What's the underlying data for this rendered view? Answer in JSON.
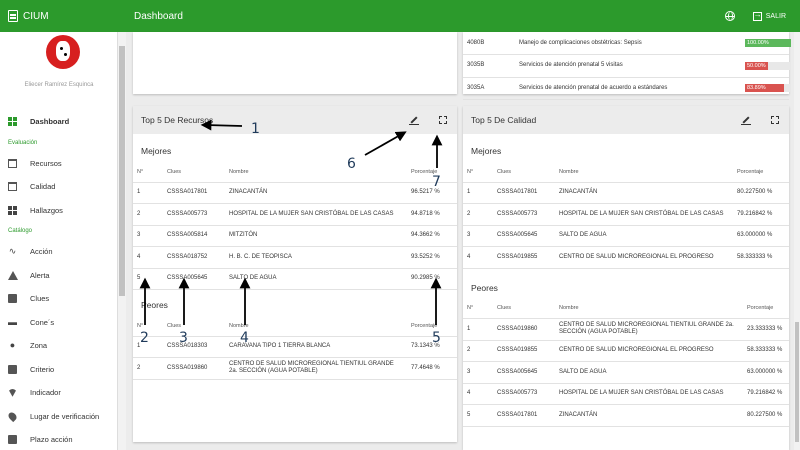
{
  "app": {
    "name": "CIUM",
    "page_title": "Dashboard",
    "logout_label": "SALIR"
  },
  "user": {
    "name": "Eliecer Ramírez Esquinca"
  },
  "sidebar": {
    "dashboard": "Dashboard",
    "section_evaluacion": "Evaluación",
    "evaluacion_items": [
      "Recursos",
      "Calidad",
      "Hallazgos"
    ],
    "section_catalogo": "Catálogo",
    "catalogo_items": [
      "Acción",
      "Alerta",
      "Clues",
      "Cone´s",
      "Zona",
      "Criterio",
      "Indicador",
      "Lugar de verificación",
      "Plazo acción"
    ]
  },
  "indicators_card": {
    "rows": [
      {
        "code": "4080B",
        "desc": "Manejo de complicaciones obstétricas: Sepsis",
        "value": "100.00%",
        "pct": 100,
        "color": "#5cb85c"
      },
      {
        "code": "3035B",
        "desc": "Servicios de atención prenatal 5 visitas",
        "value": "50.00%",
        "pct": 50,
        "color": "#d9534f"
      },
      {
        "code": "3035A",
        "desc": "Servicios de atención prenatal de acuerdo a estándares",
        "value": "83.89%",
        "pct": 83.89,
        "color": "#d9534f"
      }
    ]
  },
  "recursos": {
    "title": "Top 5 De Recursos",
    "mejores_label": "Mejores",
    "peores_label": "Peores",
    "headers": {
      "n": "N°",
      "clues": "Clues",
      "nombre": "Nombre",
      "porcentaje": "Porcentaje"
    },
    "mejores": [
      {
        "n": "1",
        "clues": "CSSSA017801",
        "nombre": "ZINACANTÁN",
        "pct": "96.5217 %"
      },
      {
        "n": "2",
        "clues": "CSSSA005773",
        "nombre": "HOSPITAL DE LA MUJER SAN CRISTÓBAL DE LAS CASAS",
        "pct": "94.8718 %"
      },
      {
        "n": "3",
        "clues": "CSSSA005814",
        "nombre": "MITZITÓN",
        "pct": "94.3662 %"
      },
      {
        "n": "4",
        "clues": "CSSSA018752",
        "nombre": "H. B. C. DE TEOPISCA",
        "pct": "93.5252 %"
      },
      {
        "n": "5",
        "clues": "CSSSA005645",
        "nombre": "SALTO DE AGUA",
        "pct": "90.2985 %"
      }
    ],
    "peores": [
      {
        "n": "1",
        "clues": "CSSSA018303",
        "nombre": "CARAVANA TIPO 1 TIERRA BLANCA",
        "pct": "73.1343 %"
      },
      {
        "n": "2",
        "clues": "CSSSA019860",
        "nombre": "CENTRO DE SALUD MICROREGIONAL TIENTIUL GRANDE 2a. SECCIÓN (AGUA POTABLE)",
        "pct": "77.4648 %"
      }
    ]
  },
  "calidad": {
    "title": "Top 5 De Calidad",
    "mejores_label": "Mejores",
    "peores_label": "Peores",
    "headers": {
      "n": "N°",
      "clues": "Clues",
      "nombre": "Nombre",
      "porcentaje": "Porcentaje"
    },
    "mejores": [
      {
        "n": "1",
        "clues": "CSSSA017801",
        "nombre": "ZINACANTÁN",
        "pct": "80.227500 %"
      },
      {
        "n": "2",
        "clues": "CSSSA005773",
        "nombre": "HOSPITAL DE LA MUJER SAN CRISTÓBAL DE LAS CASAS",
        "pct": "79.216842 %"
      },
      {
        "n": "3",
        "clues": "CSSSA005645",
        "nombre": "SALTO DE AGUA",
        "pct": "63.000000 %"
      },
      {
        "n": "4",
        "clues": "CSSSA019855",
        "nombre": "CENTRO DE SALUD MICROREGIONAL EL PROGRESO",
        "pct": "58.333333 %"
      }
    ],
    "peores": [
      {
        "n": "1",
        "clues": "CSSSA019860",
        "nombre": "CENTRO DE SALUD MICROREGIONAL TIENTIUL GRANDE 2a. SECCIÓN (AGUA POTABLE)",
        "pct": "23.333333 %"
      },
      {
        "n": "2",
        "clues": "CSSSA019855",
        "nombre": "CENTRO DE SALUD MICROREGIONAL EL PROGRESO",
        "pct": "58.333333 %"
      },
      {
        "n": "3",
        "clues": "CSSSA005645",
        "nombre": "SALTO DE AGUA",
        "pct": "63.000000 %"
      },
      {
        "n": "4",
        "clues": "CSSSA005773",
        "nombre": "HOSPITAL DE LA MUJER SAN CRISTÓBAL DE LAS CASAS",
        "pct": "79.216842 %"
      },
      {
        "n": "5",
        "clues": "CSSSA017801",
        "nombre": "ZINACANTÁN",
        "pct": "80.227500 %"
      }
    ]
  },
  "annotations": [
    "1",
    "2",
    "3",
    "4",
    "5",
    "6",
    "7"
  ]
}
